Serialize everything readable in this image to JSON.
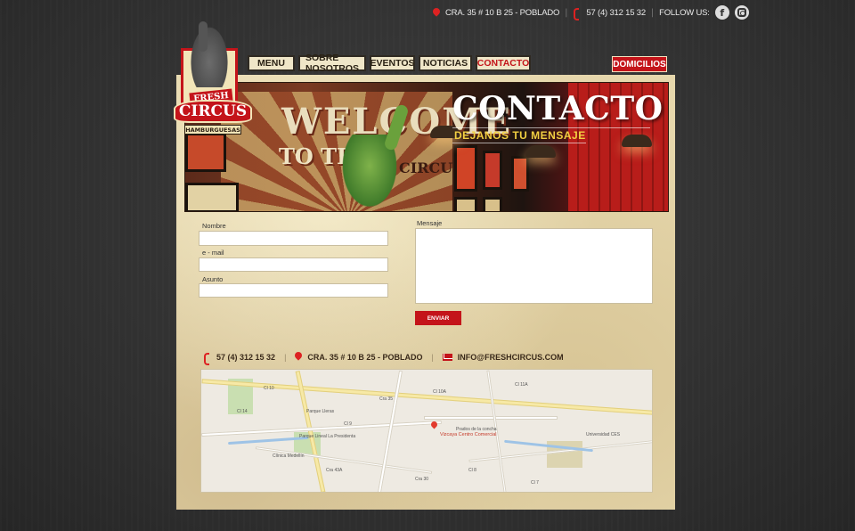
{
  "topbar": {
    "address": "CRA. 35 # 10 B 25 - POBLADO",
    "phone": "57 (4) 312 15 32",
    "follow": "FOLLOW US:",
    "facebook_glyph": "f"
  },
  "logo": {
    "fresh": "FRESH",
    "circus": "CIRCUS",
    "hamburguesas": "HAMBURGUESAS"
  },
  "nav": {
    "items": [
      "MENU",
      "SOBRE NOSOTROS",
      "EVENTOS",
      "NOTICIAS",
      "CONTACTO"
    ],
    "active": "CONTACTO",
    "domicilios": "DOMICILIOS"
  },
  "banner": {
    "title": "CONTACTO",
    "subtitle": "DEJANOS TU MENSAJE",
    "wall_welcome": "WELCOME",
    "wall_tothe": "TO THE",
    "wall_circus": "CIRCUS"
  },
  "form": {
    "nombre_label": "Nombre",
    "email_label": "e - mail",
    "asunto_label": "Asunto",
    "mensaje_label": "Mensaje",
    "submit_label": "ENVIAR"
  },
  "contact": {
    "phone": "57 (4) 312 15 32",
    "address": "CRA. 35 # 10 B 25 - POBLADO",
    "email": "INFO@FRESHCIRCUS.COM"
  },
  "map": {
    "marker_label": "Vizcaya Centro Comercial",
    "places": [
      "Parque Lleras",
      "Parque Lineal La Presidenta",
      "Universidad CES",
      "Clínica Medellín",
      "Prados de la concha"
    ],
    "streets": [
      "Cl 10",
      "Cl 10A",
      "Cl 9",
      "Cl 11A",
      "Cra 35",
      "Cra 43A",
      "Cl 8",
      "Cl 7",
      "Cra 30",
      "Cl 14"
    ]
  },
  "colors": {
    "brand_red": "#c4141a",
    "paper": "#e6d7ac",
    "subtitle_yellow": "#f2cf42"
  }
}
